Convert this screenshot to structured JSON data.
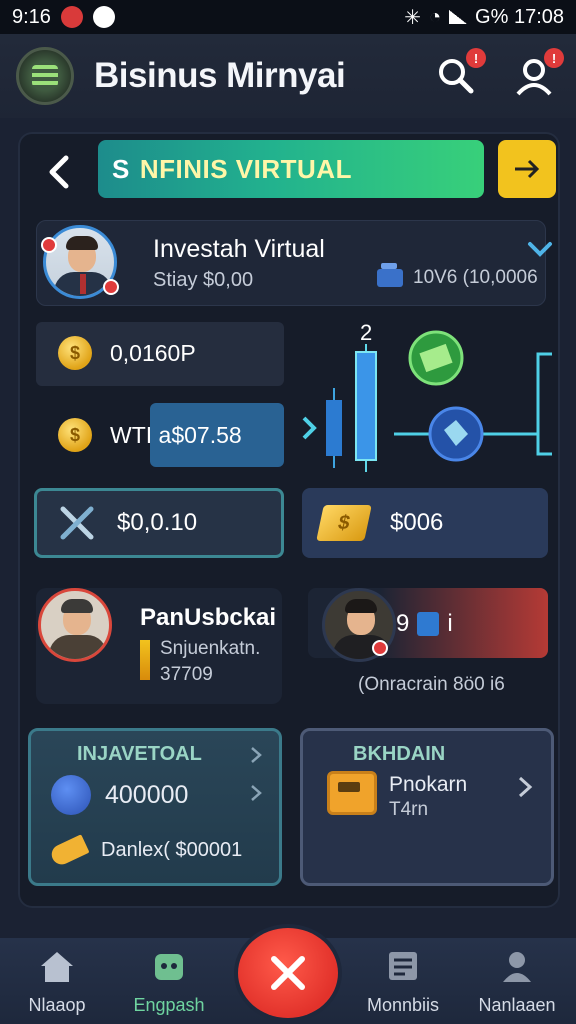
{
  "status_bar": {
    "time": "9:16",
    "right_text": "G% 17:08"
  },
  "header": {
    "title": "Bisinus Mirnyai"
  },
  "banner": {
    "lead": "S",
    "text": "NFINIS VIRTUAL"
  },
  "profile": {
    "name": "Investah Virtual",
    "subtitle": "Stiay $0,00",
    "balance_right": "10V6 (10,0006"
  },
  "balances": [
    {
      "text": "0,0160P"
    },
    {
      "text": "WTI a$07.58"
    }
  ],
  "chart": {
    "marker_label": "2"
  },
  "actions": [
    {
      "label": "$0,0.10"
    },
    {
      "label": "$006"
    }
  ],
  "person1": {
    "title": "PanUsbckai",
    "subtitle": "Snjuenkatn.",
    "value": "37709"
  },
  "person2": {
    "value": "9",
    "suffix": "i",
    "caption": "(Onracrain 8ö0 i6"
  },
  "tiles": [
    {
      "title": "INJAVETOAL",
      "amount": "400000",
      "footer": "Danlex( $00001"
    },
    {
      "title": "BKHDAIN",
      "line1": "Pnokarn",
      "line2": "T4rn"
    }
  ],
  "nav": [
    {
      "label": "Nlaaop"
    },
    {
      "label": "Engpash"
    },
    {
      "label": "Monnbiis"
    },
    {
      "label": "Nanlaaen"
    }
  ],
  "colors": {
    "accent_green": "#38d07a",
    "accent_yellow": "#f2c31e",
    "fab_red": "#e2322b"
  }
}
